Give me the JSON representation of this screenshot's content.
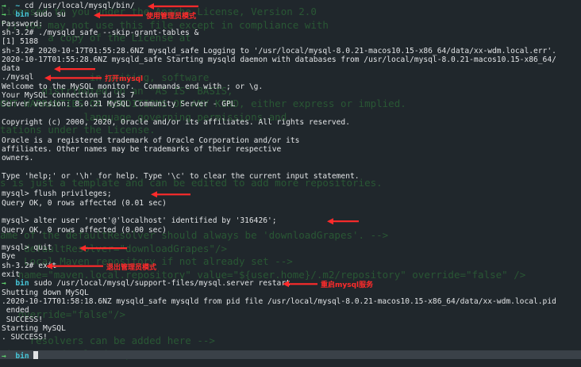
{
  "colors": {
    "background": "#20272c",
    "prompt_arrow": "#5fd06e",
    "prompt_dir": "#47c6d8",
    "annotation": "#ff2b2b",
    "ghost_text": "#2a5a35"
  },
  "ghost_text": [
    "licensed to you under the Apache License, Version 2.0",
    "\"); you may not use this file except in compliance with",
    "        a copy of the License at",
    "",
    "",
    "               in writing, software",
    "       distributed on an \"AS IS\" BASIS,",
    "OUT WARRANTIES OR CONDITIONS OF ANY KIND, either express or implied.",
    "              language governing permissions and",
    "tations under the License.",
    "",
    "",
    "",
    "s is just a template and can be edited to add more repositories.",
    "",
    "",
    "",
    "ame of the defaultResolver should always be 'downloadGrapes'. -->",
    "    defaultResolver=\"downloadGrapes\"/>",
    "    Local Maven repository if not already set -->",
    "   name=\"maven.local.repository\" value=\"${user.home}/.m2/repository\" override=\"false\" />",
    "",
    "",
    "   override=\"false\"/>",
    "",
    "     resolvers can be added here -->",
    "ain name=\"downloadGrapes\">"
  ],
  "terminal_lines": [
    {
      "prompt": "→",
      "dir": "~",
      "text": "cd /usr/local/mysql/bin/"
    },
    {
      "prompt": "→",
      "dir": "bin",
      "text": "sudo su"
    },
    {
      "text": "Password:"
    },
    {
      "text": "sh-3.2# ./mysqld_safe --skip-grant-tables &"
    },
    {
      "text": "[1] 5188"
    },
    {
      "text": "sh-3.2# 2020-10-17T01:55:28.6NZ mysqld_safe Logging to '/usr/local/mysql-8.0.21-macos10.15-x86_64/data/xx-wdm.local.err'."
    },
    {
      "text": "2020-10-17T01:55:28.6NZ mysqld_safe Starting mysqld daemon with databases from /usr/local/mysql-8.0.21-macos10.15-x86_64/"
    },
    {
      "text": "data"
    },
    {
      "text": "./mysql"
    },
    {
      "text": "Welcome to the MySQL monitor.  Commands end with ; or \\g."
    },
    {
      "text": "Your MySQL connection id is 7"
    },
    {
      "text": "Server version: 8.0.21 MySQL Community Server - GPL"
    },
    {
      "text": ""
    },
    {
      "text": "Copyright (c) 2000, 2020, Oracle and/or its affiliates. All rights reserved."
    },
    {
      "text": ""
    },
    {
      "text": "Oracle is a registered trademark of Oracle Corporation and/or its"
    },
    {
      "text": "affiliates. Other names may be trademarks of their respective"
    },
    {
      "text": "owners."
    },
    {
      "text": ""
    },
    {
      "text": "Type 'help;' or '\\h' for help. Type '\\c' to clear the current input statement."
    },
    {
      "text": ""
    },
    {
      "text": "mysql> flush privileges;"
    },
    {
      "text": "Query OK, 0 rows affected (0.01 sec)"
    },
    {
      "text": ""
    },
    {
      "text": "mysql> alter user 'root'@'localhost' identified by '316426';"
    },
    {
      "text": "Query OK, 0 rows affected (0.00 sec)"
    },
    {
      "text": ""
    },
    {
      "text": "mysql> quit"
    },
    {
      "text": "Bye"
    },
    {
      "text": "sh-3.2# exit"
    },
    {
      "text": "exit"
    },
    {
      "prompt": "→",
      "dir": "bin",
      "text": "sudo /usr/local/mysql/support-files/mysql.server restart"
    },
    {
      "text": "Shutting down MySQL"
    },
    {
      "text": ".2020-10-17T01:58:18.6NZ mysqld_safe mysqld from pid file /usr/local/mysql-8.0.21-macos10.15-x86_64/data/xx-wdm.local.pid"
    },
    {
      "text": " ended"
    },
    {
      "text": " SUCCESS!"
    },
    {
      "text": "Starting MySQL"
    },
    {
      "text": ". SUCCESS!"
    },
    {
      "text": ""
    },
    {
      "prompt": "→",
      "dir": "bin",
      "text": ""
    }
  ],
  "annotations": [
    {
      "label": "使用管理员模式",
      "line": 1
    },
    {
      "label": "打开mysql",
      "line": 8
    },
    {
      "label": "退出管理员模式",
      "line": 29
    },
    {
      "label": "重启mysql服务",
      "line": 31
    }
  ]
}
